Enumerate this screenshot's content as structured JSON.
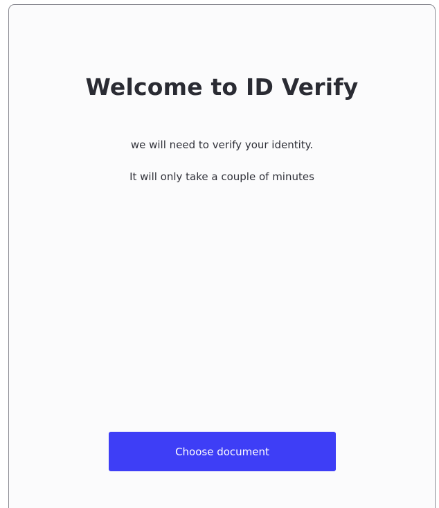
{
  "welcome": {
    "title": "Welcome to ID Verify",
    "line1": "we will need to verify your identity.",
    "line2": "It will only take a couple of minutes",
    "button_label": "Choose document"
  },
  "colors": {
    "button_bg": "#3e3ef6",
    "card_bg": "#fbfbfc",
    "text": "#2a2b33"
  }
}
